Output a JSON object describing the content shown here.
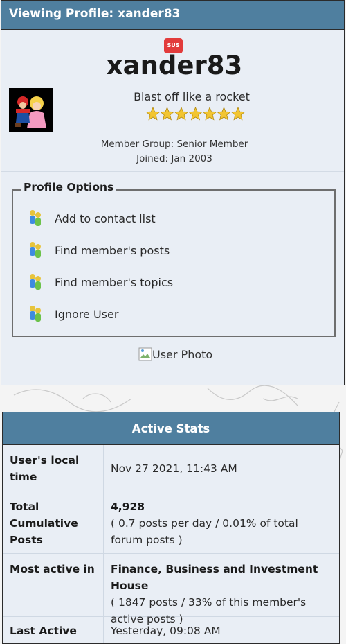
{
  "profile": {
    "header_title": "Viewing Profile: xander83",
    "badge": "SUS",
    "username": "xander83",
    "tagline": "Blast off like a rocket",
    "star_rating": 7,
    "member_group": "Member Group: Senior Member",
    "joined": "Joined: Jan 2003",
    "options_title": "Profile Options",
    "options": [
      {
        "label": "Add to contact list",
        "icon": "people-icon"
      },
      {
        "label": "Find member's posts",
        "icon": "people-icon"
      },
      {
        "label": "Find member's topics",
        "icon": "people-icon"
      },
      {
        "label": "Ignore User",
        "icon": "people-icon"
      }
    ],
    "user_photo_alt": "User Photo"
  },
  "stats": {
    "title": "Active Stats",
    "local_time_label": "User's local time",
    "local_time_value": "Nov 27 2021, 11:43 AM",
    "total_posts_label": "Total Cumulative Posts",
    "total_posts_value": "4,928",
    "total_posts_detail": "( 0.7 posts per day / 0.01% of total forum posts )",
    "most_active_label": "Most active in",
    "most_active_value": "Finance, Business and Investment House",
    "most_active_detail": "( 1847 posts / 33% of this member's active posts )",
    "last_active_label": "Last Active",
    "last_active_value": "Yesterday, 09:08 AM"
  },
  "colors": {
    "header_bg": "#4f7f9f",
    "panel_bg": "#e9eef5",
    "badge_bg": "#e23b3b",
    "star": "#f2c531"
  }
}
